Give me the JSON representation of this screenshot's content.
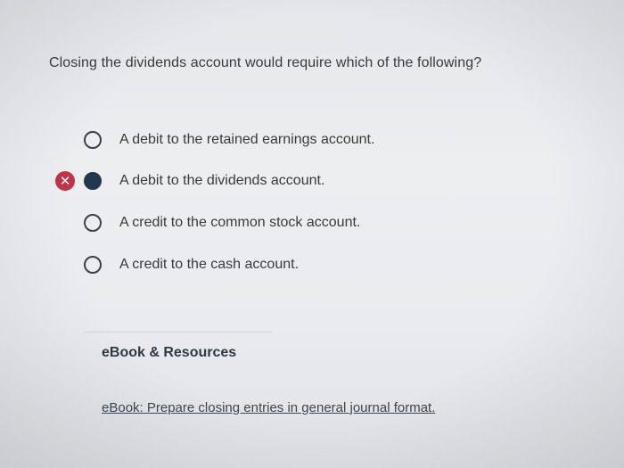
{
  "question": "Closing the dividends account would require which of the following?",
  "options": [
    {
      "label": "A debit to the retained earnings account.",
      "selected": false,
      "marked_wrong": false
    },
    {
      "label": "A debit to the dividends account.",
      "selected": true,
      "marked_wrong": true
    },
    {
      "label": "A credit to the common stock account.",
      "selected": false,
      "marked_wrong": false
    },
    {
      "label": "A credit to the cash account.",
      "selected": false,
      "marked_wrong": false
    }
  ],
  "wrong_icon_glyph": "✕",
  "colors": {
    "wrong_badge": "#c0344a",
    "selected_radio": "#23374d"
  },
  "resources": {
    "title": "eBook & Resources",
    "link": "eBook: Prepare closing entries in general journal format."
  }
}
